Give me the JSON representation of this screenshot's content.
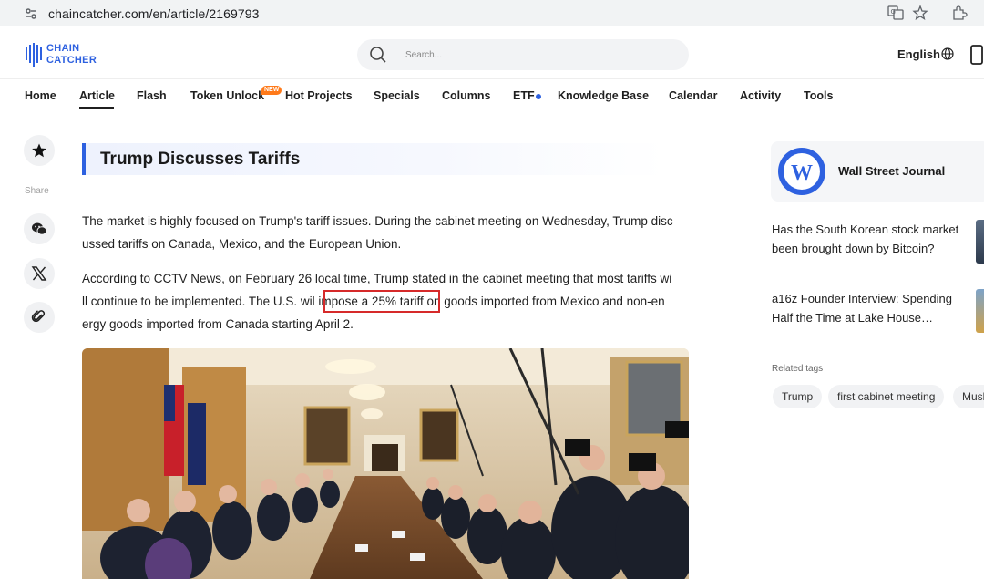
{
  "browser": {
    "url": "chaincatcher.com/en/article/2169793"
  },
  "header": {
    "logo_line1": "CHAIN",
    "logo_line2": "CATCHER",
    "search_placeholder": "Search...",
    "language": "English",
    "brand_color": "#2e61e0"
  },
  "nav": {
    "items": [
      {
        "label": "Home"
      },
      {
        "label": "Article"
      },
      {
        "label": "Flash"
      },
      {
        "label": "Token Unlock"
      },
      {
        "label": "Hot Projects"
      },
      {
        "label": "Specials"
      },
      {
        "label": "Columns"
      },
      {
        "label": "ETF"
      },
      {
        "label": "Knowledge Base"
      },
      {
        "label": "Calendar"
      },
      {
        "label": "Activity"
      },
      {
        "label": "Tools"
      }
    ],
    "badge": "NEW",
    "active": "Article"
  },
  "sidebar": {
    "share_label": "Share",
    "icons": [
      "star-icon",
      "wechat-icon",
      "x-icon",
      "link-icon"
    ]
  },
  "article": {
    "title": "Trump Discusses Tariffs",
    "p1_line1": "The market is highly focused on Trump's tariff issues. During the cabinet meeting on Wednesday, Trump disc",
    "p1_line2": "ussed tariffs on Canada, Mexico, and the European Union.",
    "p2_source": "According to CCTV News",
    "p2_line1_rest": ", on February 26 local time, Trump stated in the cabinet meeting that most tariffs wi",
    "p2_line2_pre": "ll continue to be implemented. The U.S. wil",
    "p2_highlight": "impose a 25% tariff",
    "p2_line2_post": " on goods imported from Mexico and non-en",
    "p2_line3": "ergy goods imported from Canada starting April 2.",
    "highlight_color": "#d62a2a"
  },
  "right": {
    "source_name": "Wall Street Journal",
    "articles": [
      {
        "line1": "Has the South Korean stock market",
        "line2": "been brought down by Bitcoin?"
      },
      {
        "line1": "a16z Founder Interview: Spending",
        "line2": "Half the Time at Lake House…"
      }
    ],
    "related_label": "Related tags",
    "tags": [
      "Trump",
      "first cabinet meeting",
      "Musk"
    ]
  }
}
